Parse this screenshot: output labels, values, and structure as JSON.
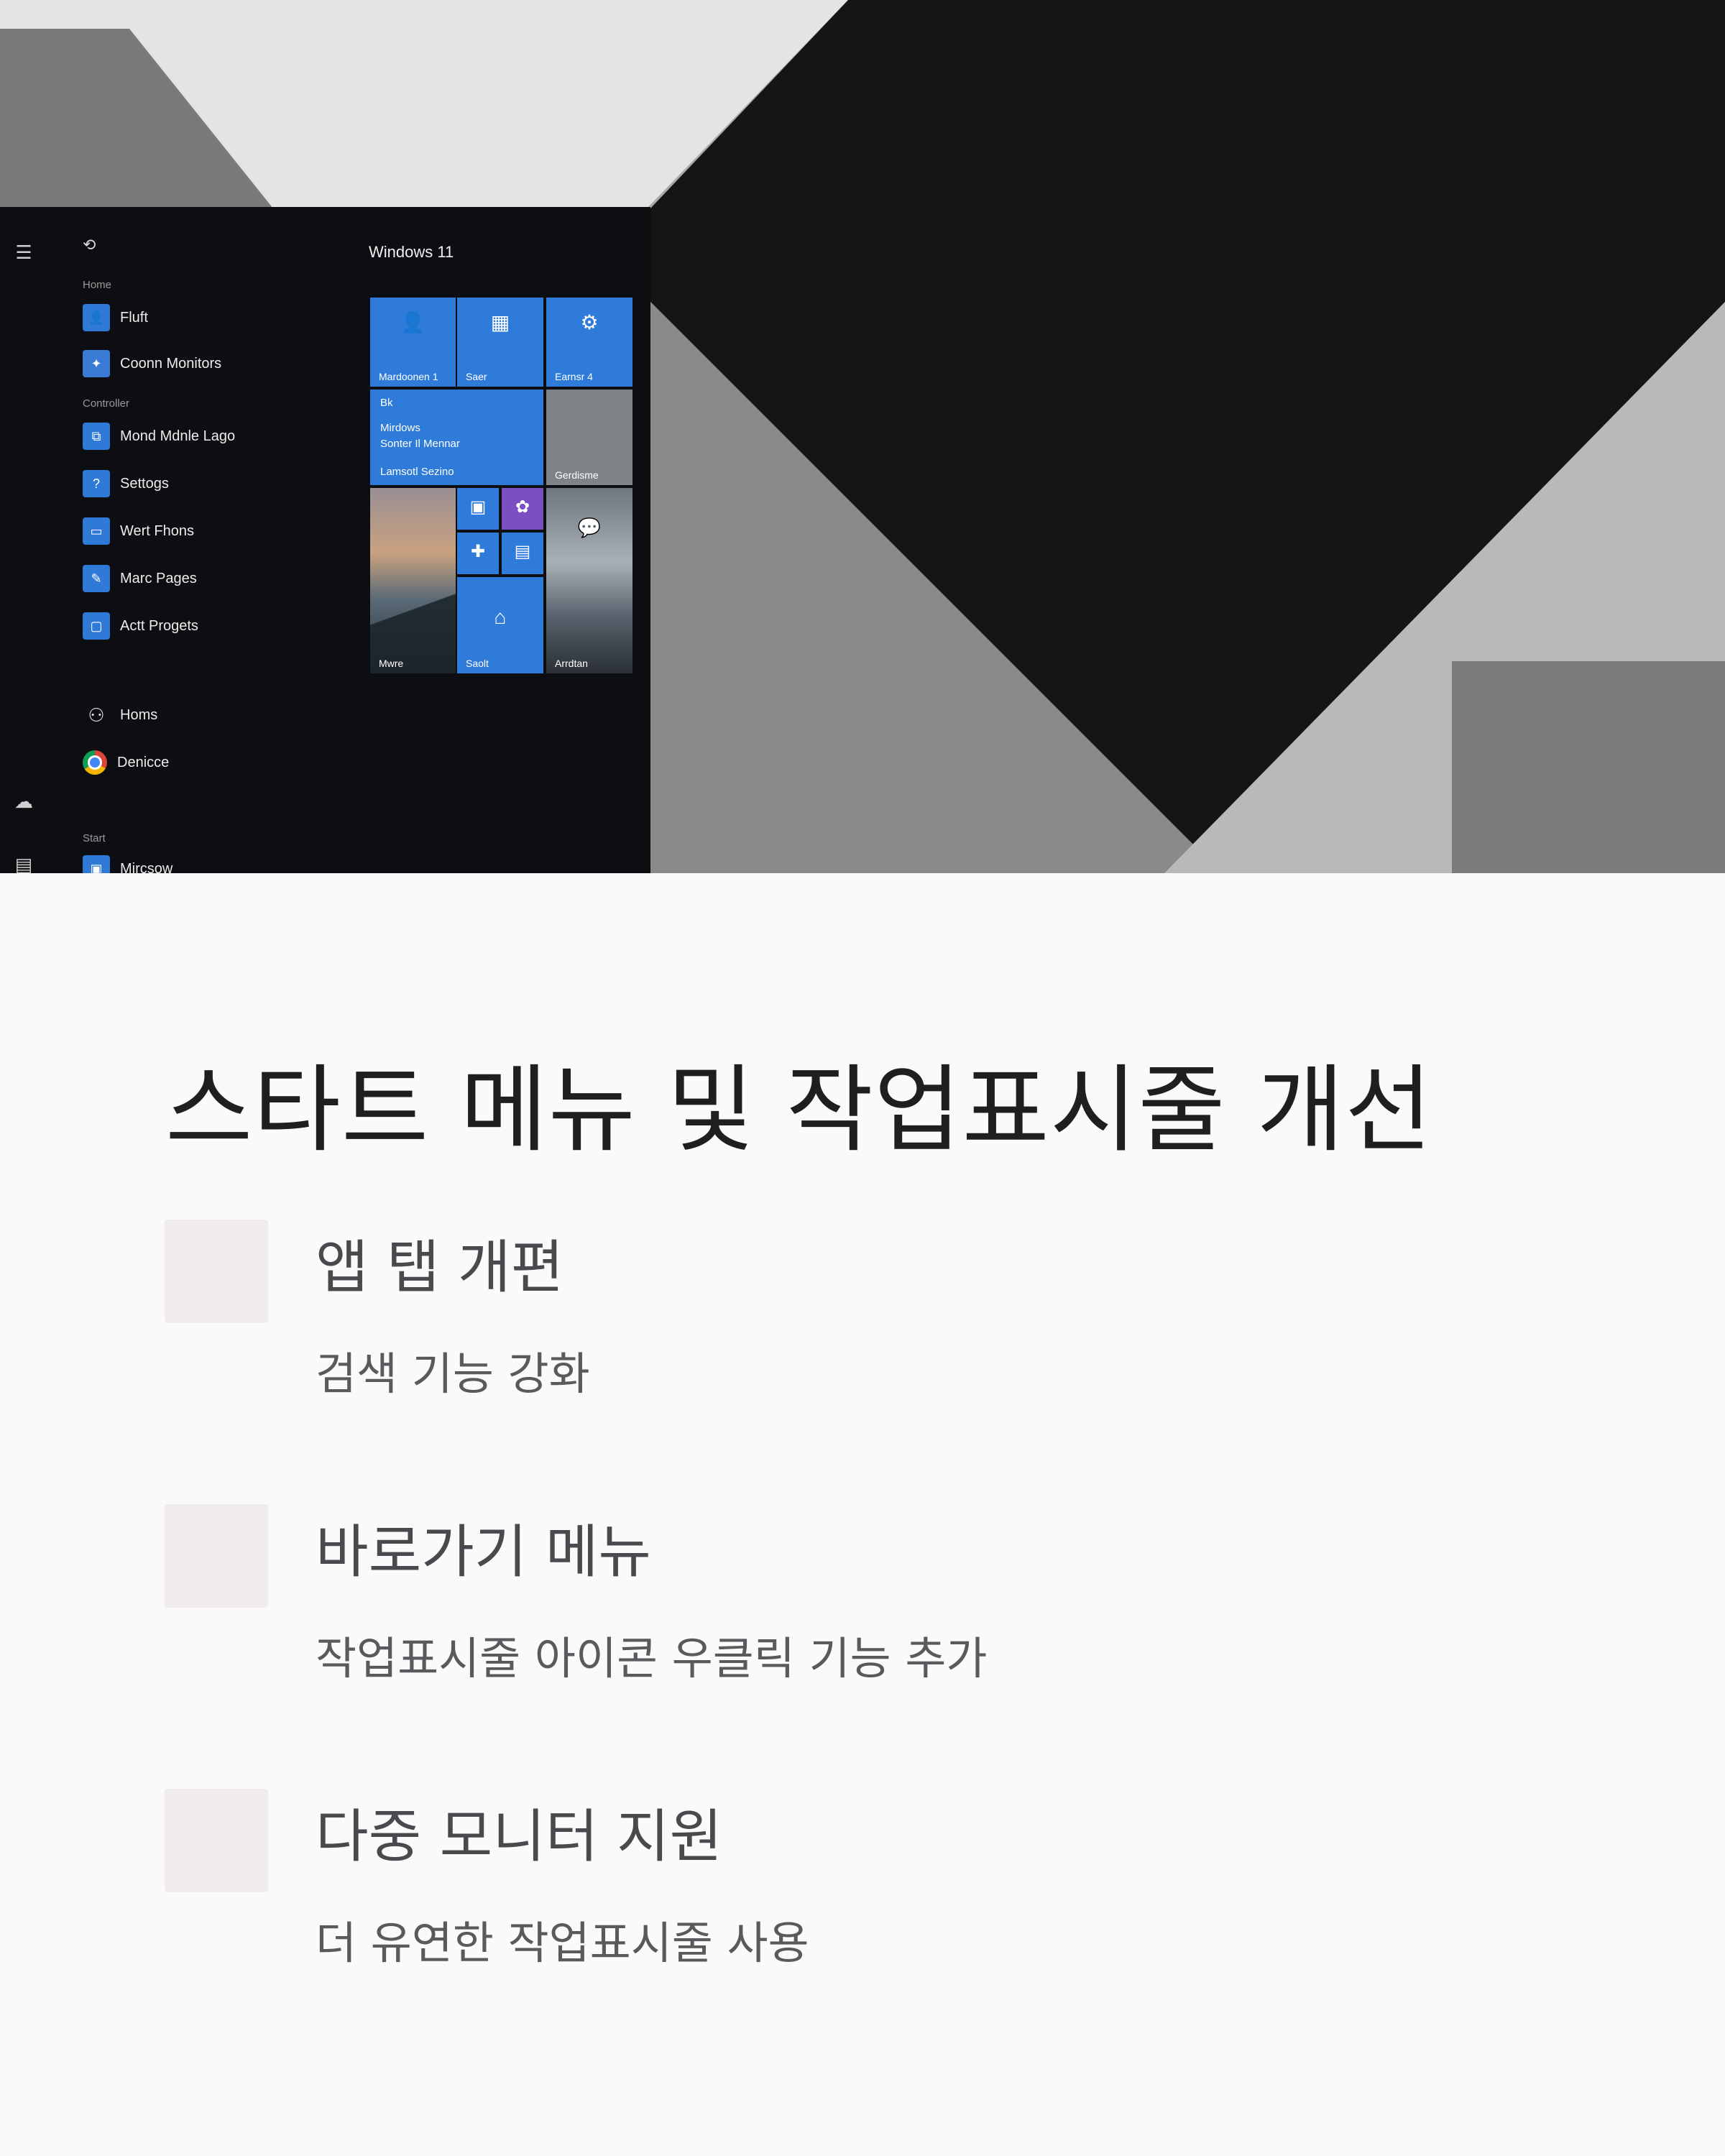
{
  "hero": {
    "window_title": "Windows 11",
    "list": {
      "sections": [
        "Home",
        "Controller",
        "Start"
      ],
      "pinned": [
        {
          "label": "Fluft",
          "icon": "user-app-icon"
        },
        {
          "label": "Coonn Monitors",
          "icon": "tools-icon"
        }
      ],
      "apps": [
        {
          "label": "Mond Mdnle Lago",
          "icon": "network-icon"
        },
        {
          "label": "Settogs",
          "icon": "question-icon"
        },
        {
          "label": "Wert Fhons",
          "icon": "window-icon"
        },
        {
          "label": "Marc Pages",
          "icon": "edit-icon"
        },
        {
          "label": "Actt Progets",
          "icon": "chat-icon"
        }
      ],
      "bottom": [
        {
          "label": "Homs",
          "icon": "people-icon"
        },
        {
          "label": "Denicce",
          "icon": "chrome-icon"
        }
      ],
      "last_label": "Mircsow"
    },
    "tiles": {
      "t1": "Mardoonen 1",
      "t2": "Saer",
      "t3": "Earnsr 4",
      "t4_lines": [
        "Bk",
        "Mirdows",
        "Sonter Il Mennar",
        "Lamsotl Sezino"
      ],
      "t5": "Gerdisme",
      "t6": "Mwre",
      "t7": "Saolt",
      "t8": "Arrdtan"
    }
  },
  "title": "스타트 메뉴 및 작업표시줄 개선",
  "features": [
    {
      "heading": "앱 탭 개편",
      "description": "검색 기능 강화"
    },
    {
      "heading": "바로가기 메뉴",
      "description": "작업표시줄 아이콘 우클릭 기능 추가"
    },
    {
      "heading": "다중 모니터 지원",
      "description": "더 유연한 작업표시줄 사용"
    }
  ]
}
